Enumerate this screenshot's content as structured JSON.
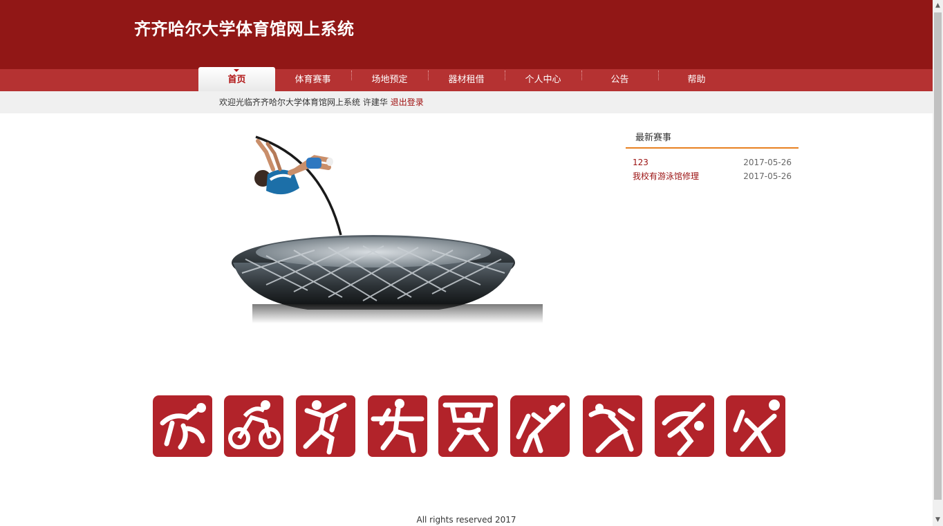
{
  "header": {
    "title": "齐齐哈尔大学体育馆网上系统"
  },
  "nav": {
    "items": [
      {
        "label": "首页",
        "active": true
      },
      {
        "label": "体育赛事"
      },
      {
        "label": "场地预定"
      },
      {
        "label": "器材租借"
      },
      {
        "label": "个人中心"
      },
      {
        "label": "公告"
      },
      {
        "label": "帮助"
      }
    ]
  },
  "welcome": {
    "text": "欢迎光临齐齐哈尔大学体育馆网上系统",
    "user": "许建华",
    "logout": "退出登录"
  },
  "news": {
    "title": "最新赛事",
    "items": [
      {
        "name": "123",
        "date": "2017-05-26"
      },
      {
        "name": "我校有游泳馆修理",
        "date": "2017-05-26"
      }
    ]
  },
  "seals": [
    {
      "icon": "swimming-seal-icon"
    },
    {
      "icon": "cycling-seal-icon"
    },
    {
      "icon": "running-seal-icon"
    },
    {
      "icon": "fencing-seal-icon"
    },
    {
      "icon": "weightlifting-seal-icon"
    },
    {
      "icon": "gymnastics-seal-icon"
    },
    {
      "icon": "wrestling-seal-icon"
    },
    {
      "icon": "badminton-seal-icon"
    },
    {
      "icon": "volleyball-seal-icon"
    }
  ],
  "footer": {
    "text": "All rights reserved 2017"
  },
  "colors": {
    "header": "#911716",
    "nav": "#b53232",
    "accent": "#e88020",
    "seal": "#b2232a"
  }
}
